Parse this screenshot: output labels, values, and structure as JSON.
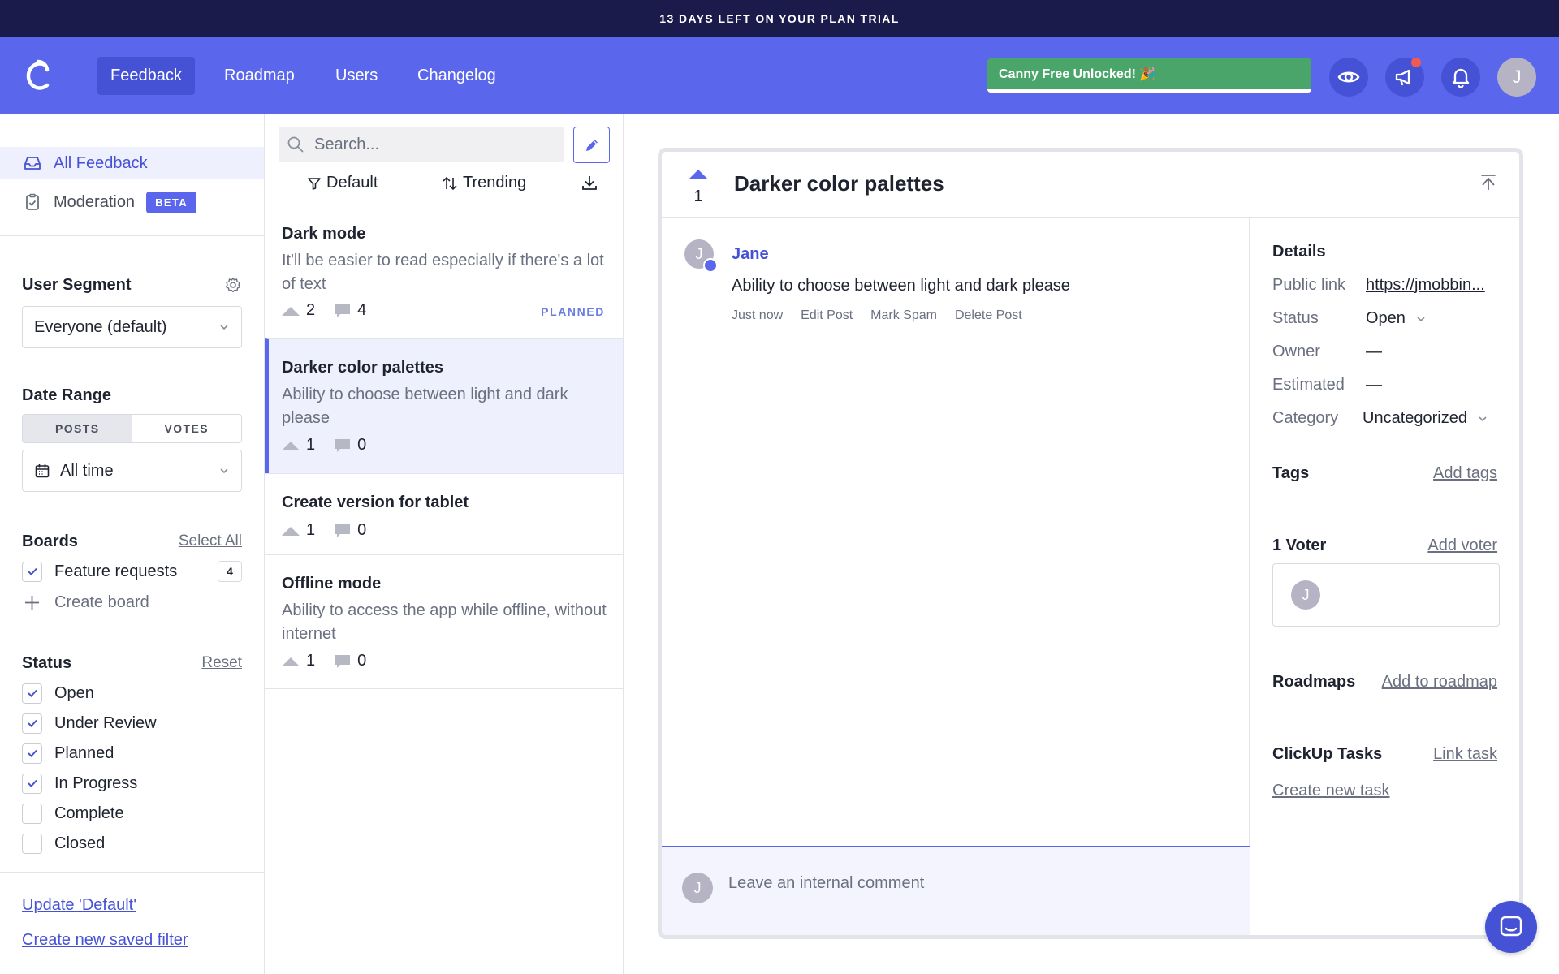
{
  "banner": {
    "text": "13 DAYS LEFT ON YOUR PLAN TRIAL"
  },
  "nav": {
    "tabs": [
      "Feedback",
      "Roadmap",
      "Users",
      "Changelog"
    ],
    "active": "Feedback",
    "unlocked_label": "Canny Free Unlocked! 🎉",
    "avatar_initial": "J"
  },
  "sidebar": {
    "links": [
      {
        "label": "All Feedback",
        "icon": "inbox-icon",
        "active": true
      },
      {
        "label": "Moderation",
        "icon": "clipboard-icon",
        "badge": "BETA"
      }
    ],
    "user_segment": {
      "title": "User Segment",
      "value": "Everyone (default)"
    },
    "date_range": {
      "title": "Date Range",
      "toggle": [
        "POSTS",
        "VOTES"
      ],
      "selected_toggle": "POSTS",
      "value": "All time"
    },
    "boards": {
      "title": "Boards",
      "action": "Select All",
      "items": [
        {
          "label": "Feature requests",
          "count": "4",
          "checked": true
        }
      ],
      "create": "Create board"
    },
    "status": {
      "title": "Status",
      "action": "Reset",
      "items": [
        {
          "label": "Open",
          "checked": true
        },
        {
          "label": "Under Review",
          "checked": true
        },
        {
          "label": "Planned",
          "checked": true
        },
        {
          "label": "In Progress",
          "checked": true
        },
        {
          "label": "Complete",
          "checked": false
        },
        {
          "label": "Closed",
          "checked": false
        }
      ]
    },
    "footer_links": [
      "Update 'Default'",
      "Create new saved filter"
    ]
  },
  "list": {
    "search_placeholder": "Search...",
    "filter_label": "Default",
    "sort_label": "Trending",
    "posts": [
      {
        "title": "Dark mode",
        "desc": "It'll be easier to read especially if there's a lot of text",
        "votes": "2",
        "comments": "4",
        "status": "PLANNED"
      },
      {
        "title": "Darker color palettes",
        "desc": "Ability to choose between light and dark please",
        "votes": "1",
        "comments": "0",
        "selected": true
      },
      {
        "title": "Create version for tablet",
        "desc": "",
        "votes": "1",
        "comments": "0"
      },
      {
        "title": "Offline mode",
        "desc": "Ability to access the app while offline, without internet",
        "votes": "1",
        "comments": "0"
      }
    ]
  },
  "detail": {
    "votes": "1",
    "title": "Darker color palettes",
    "author": "Jane",
    "author_initial": "J",
    "body": "Ability to choose between light and dark please",
    "meta": [
      "Just now",
      "Edit Post",
      "Mark Spam",
      "Delete Post"
    ],
    "comment_placeholder": "Leave an internal comment",
    "side": {
      "details_title": "Details",
      "public_link_label": "Public link",
      "public_link_value": "https://jmobbin...",
      "status_label": "Status",
      "status_value": "Open",
      "owner_label": "Owner",
      "owner_value": "—",
      "estimated_label": "Estimated",
      "estimated_value": "—",
      "category_label": "Category",
      "category_value": "Uncategorized",
      "tags_title": "Tags",
      "tags_action": "Add tags",
      "voters_title": "1 Voter",
      "voters_action": "Add voter",
      "voter_initial": "J",
      "roadmaps_title": "Roadmaps",
      "roadmaps_action": "Add to roadmap",
      "clickup_title": "ClickUp Tasks",
      "clickup_action": "Link task",
      "clickup_create": "Create new task"
    }
  },
  "colors": {
    "brand": "#5a67ed",
    "banner": "#1b1b4b",
    "success": "#4aa56a",
    "selected_bg": "#eef0fd"
  }
}
